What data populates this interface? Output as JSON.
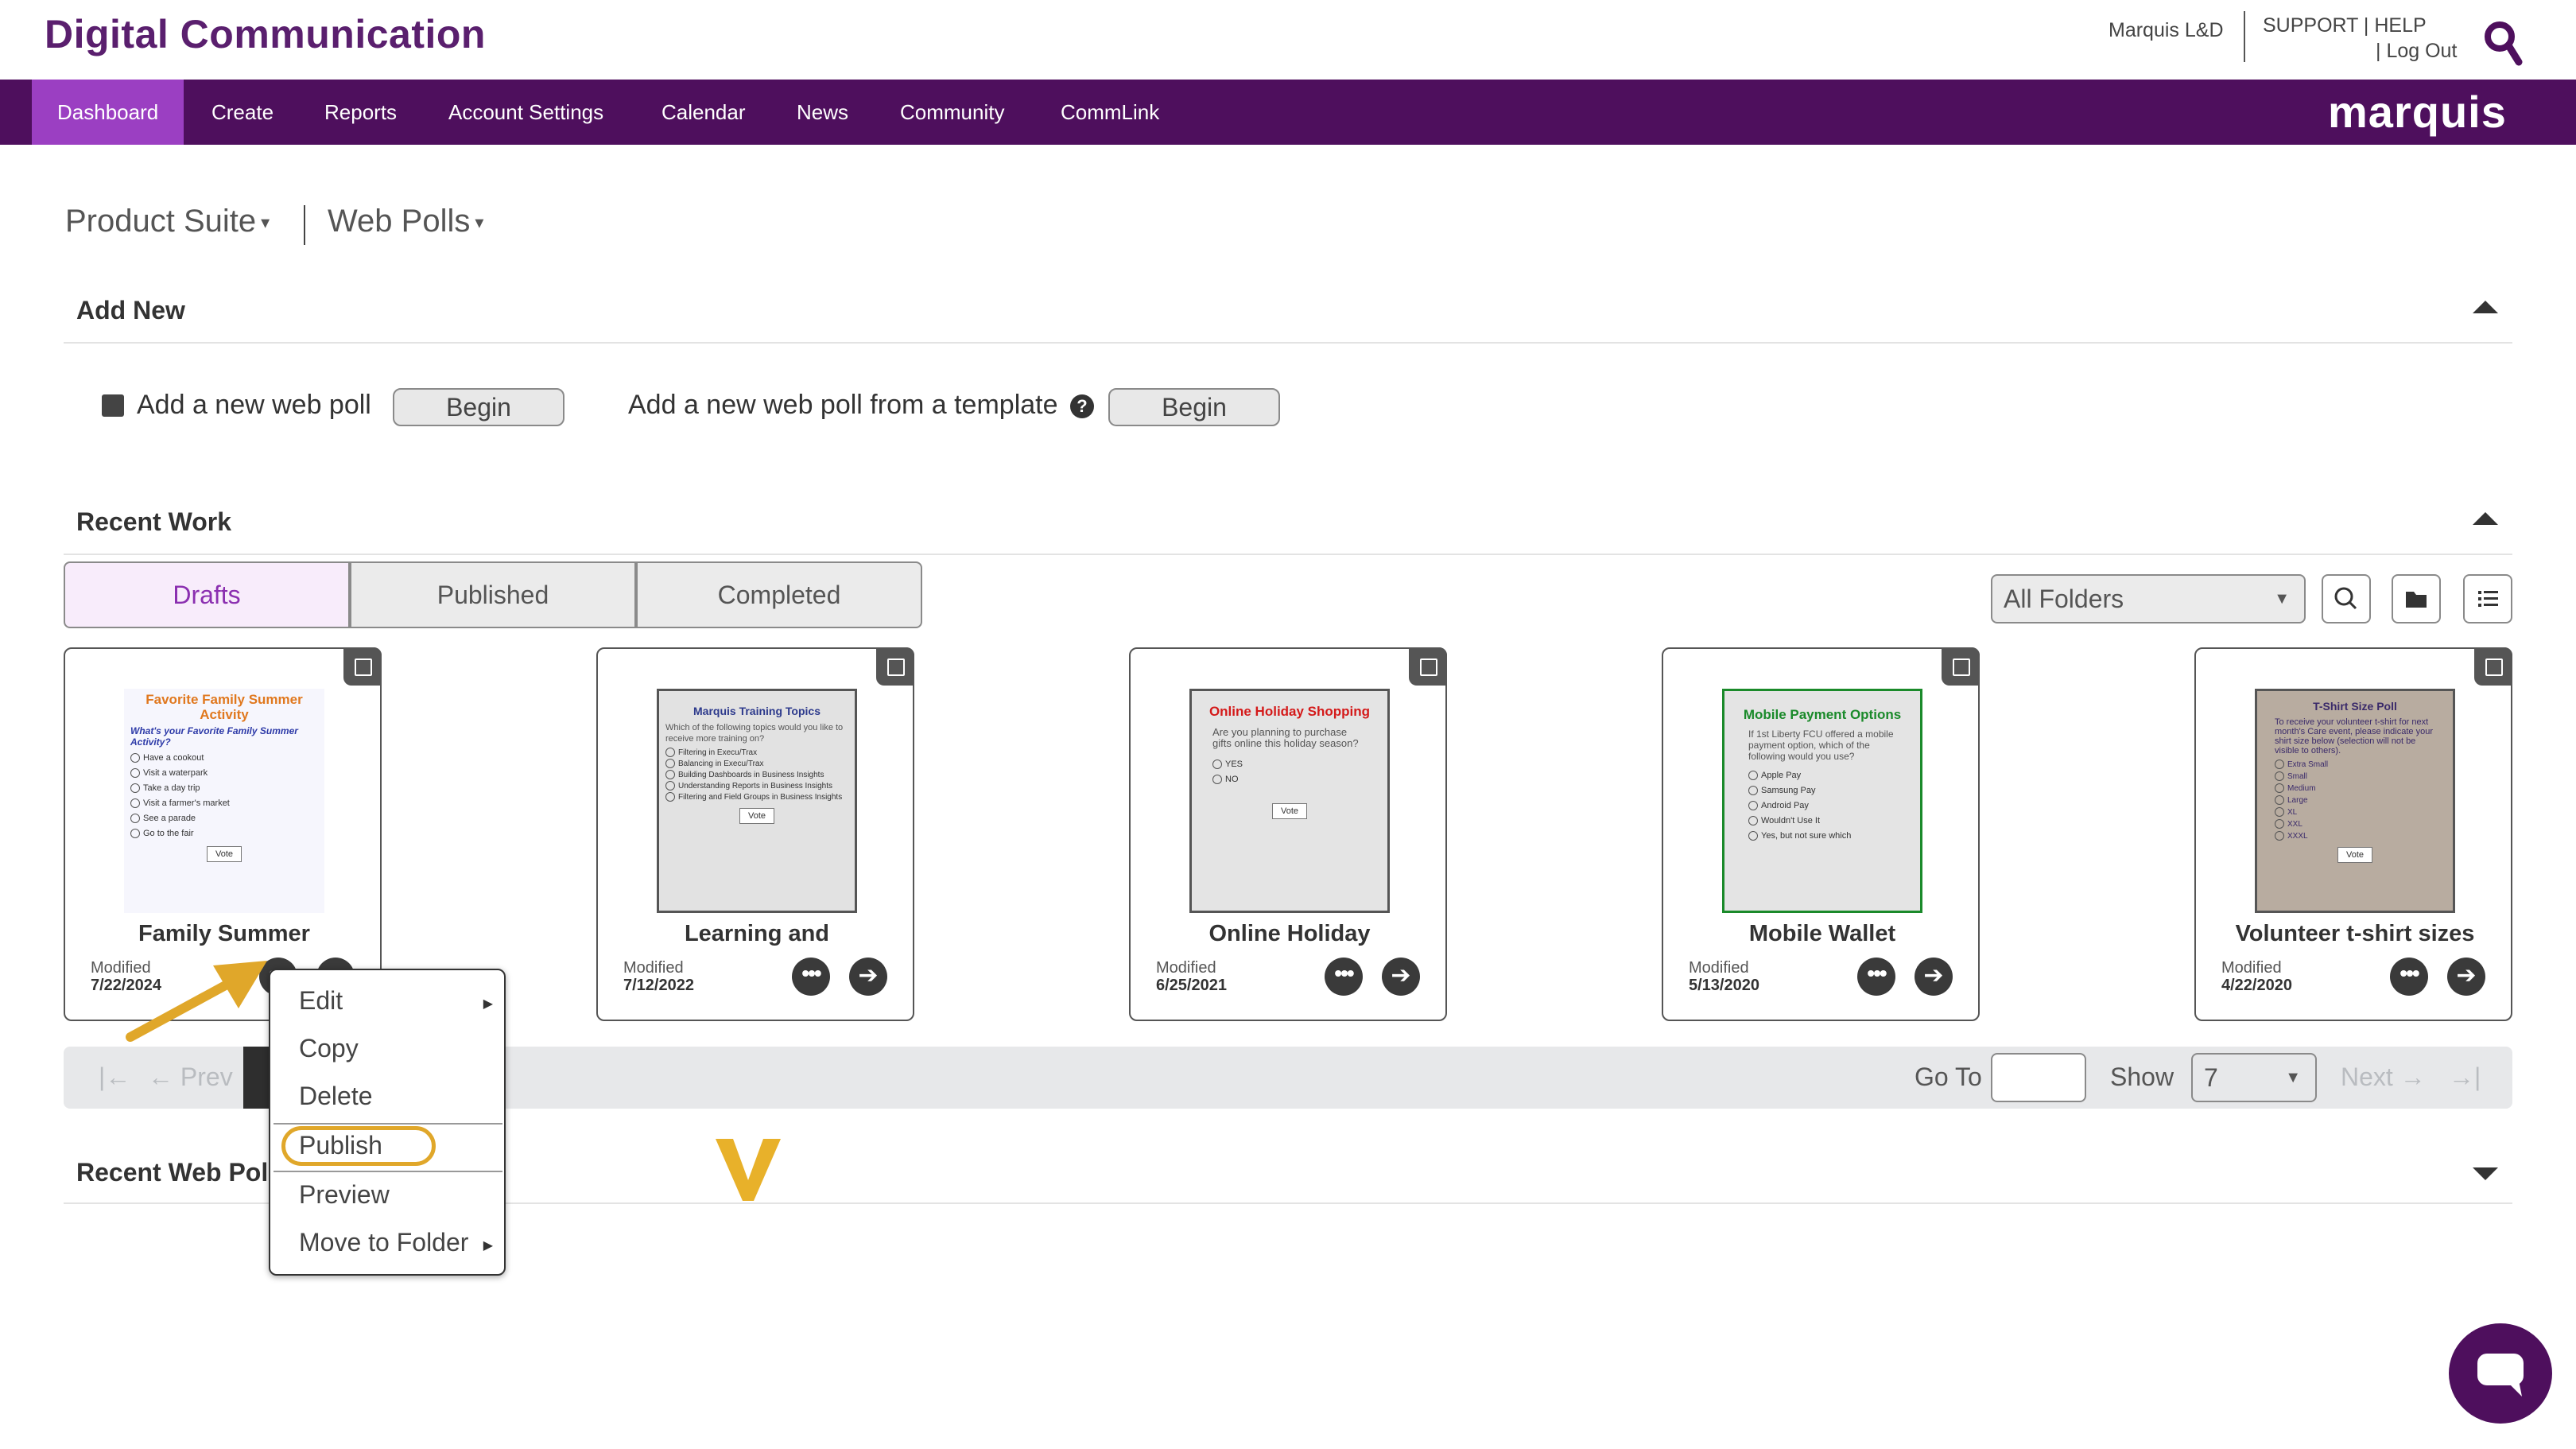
{
  "header": {
    "app_title": "Digital Communication",
    "user_name": "Marquis L&D",
    "support": "SUPPORT",
    "sep1": "|",
    "help": "HELP",
    "sep2": "|",
    "logout": "Log Out"
  },
  "nav": {
    "items": [
      "Dashboard",
      "Create",
      "Reports",
      "Account Settings",
      "Calendar",
      "News",
      "Community",
      "CommLink"
    ],
    "active": "Dashboard",
    "brand": "marquis"
  },
  "breadcrumb": {
    "product": "Product Suite",
    "section": "Web Polls",
    "caret": "▾"
  },
  "add_new": {
    "title": "Add New",
    "new_poll_label": "Add a new web poll",
    "begin_label": "Begin",
    "template_label": "Add a new web poll from a template",
    "template_begin_label": "Begin",
    "help_glyph": "?"
  },
  "recent_work": {
    "title": "Recent Work",
    "tabs": [
      "Drafts",
      "Published",
      "Completed"
    ],
    "active_tab": "Drafts",
    "folder_filter": "All Folders",
    "dropdown_glyph": "▼"
  },
  "cards": [
    {
      "title": "Family Summer",
      "modified_label": "Modified",
      "date": "7/22/2024",
      "thumb": {
        "title": "Favorite Family Summer Activity",
        "question": "What's your Favorite Family Summer Activity?",
        "options": [
          "Have a cookout",
          "Visit a waterpark",
          "Take a day trip",
          "Visit a farmer's market",
          "See a parade",
          "Go to the fair"
        ],
        "vote": "Vote"
      }
    },
    {
      "title": "Learning and",
      "modified_label": "Modified",
      "date": "7/12/2022",
      "thumb": {
        "title": "Marquis Training Topics",
        "question": "Which of the following topics would you like to receive more training on?",
        "options": [
          "Filtering in Execu/Trax",
          "Balancing in Execu/Trax",
          "Building Dashboards in Business Insights",
          "Understanding Reports in Business Insights",
          "Filtering and Field Groups in Business Insights"
        ],
        "vote": "Vote"
      }
    },
    {
      "title": "Online Holiday",
      "modified_label": "Modified",
      "date": "6/25/2021",
      "thumb": {
        "title": "Online Holiday Shopping",
        "question": "Are you planning to purchase gifts online this holiday season?",
        "options": [
          "YES",
          "NO"
        ],
        "vote": "Vote"
      }
    },
    {
      "title": "Mobile Wallet",
      "modified_label": "Modified",
      "date": "5/13/2020",
      "thumb": {
        "title": "Mobile Payment Options",
        "question": "If 1st Liberty FCU offered a mobile payment option, which of the following would you use?",
        "options": [
          "Apple Pay",
          "Samsung Pay",
          "Android Pay",
          "Wouldn't Use It",
          "Yes, but not sure which"
        ],
        "vote": "Vote"
      }
    },
    {
      "title": "Volunteer t-shirt sizes",
      "modified_label": "Modified",
      "date": "4/22/2020",
      "thumb": {
        "title": "T-Shirt Size Poll",
        "question": "To receive your volunteer t-shirt for next month's Care event, please indicate your shirt size below (selection will not be visible to others).",
        "options": [
          "Extra Small",
          "Small",
          "Medium",
          "Large",
          "XL",
          "XXL",
          "XXXL"
        ],
        "vote": "Vote"
      }
    }
  ],
  "card_buttons": {
    "more": "•••",
    "open": "➔"
  },
  "pager": {
    "first": "|←",
    "prev": "← Prev",
    "goto_label": "Go To",
    "show_label": "Show",
    "show_value": "7",
    "next": "Next →",
    "last": "→|"
  },
  "context_menu": {
    "items": [
      "Edit",
      "Copy",
      "Delete",
      "Publish",
      "Preview",
      "Move to Folder"
    ],
    "submenu_glyph": "▶"
  },
  "recent_web_polls": {
    "title": "Recent Web Pol"
  },
  "colors": {
    "brand_purple": "#4e0f5d",
    "nav_active": "#9b3fc2",
    "annotation": "#e0a72a"
  }
}
